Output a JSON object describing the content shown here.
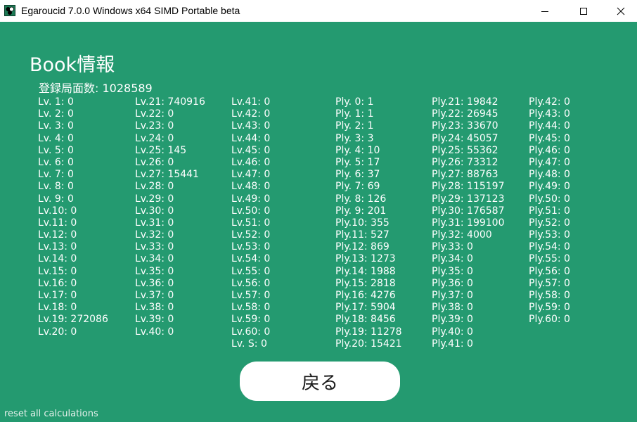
{
  "window": {
    "title": "Egaroucid 7.0.0 Windows x64 SIMD Portable beta",
    "icons": [
      "app-icon",
      "minimize-icon",
      "maximize-icon",
      "close-icon"
    ]
  },
  "book": {
    "heading": "Book情報",
    "total": "登録局面数: 1028589"
  },
  "columns": [
    [
      "Lv. 1: 0",
      "Lv. 2: 0",
      "Lv. 3: 0",
      "Lv. 4: 0",
      "Lv. 5: 0",
      "Lv. 6: 0",
      "Lv. 7: 0",
      "Lv. 8: 0",
      "Lv. 9: 0",
      "Lv.10: 0",
      "Lv.11: 0",
      "Lv.12: 0",
      "Lv.13: 0",
      "Lv.14: 0",
      "Lv.15: 0",
      "Lv.16: 0",
      "Lv.17: 0",
      "Lv.18: 0",
      "Lv.19: 272086",
      "Lv.20: 0"
    ],
    [
      "Lv.21: 740916",
      "Lv.22: 0",
      "Lv.23: 0",
      "Lv.24: 0",
      "Lv.25: 145",
      "Lv.26: 0",
      "Lv.27: 15441",
      "Lv.28: 0",
      "Lv.29: 0",
      "Lv.30: 0",
      "Lv.31: 0",
      "Lv.32: 0",
      "Lv.33: 0",
      "Lv.34: 0",
      "Lv.35: 0",
      "Lv.36: 0",
      "Lv.37: 0",
      "Lv.38: 0",
      "Lv.39: 0",
      "Lv.40: 0"
    ],
    [
      "Lv.41: 0",
      "Lv.42: 0",
      "Lv.43: 0",
      "Lv.44: 0",
      "Lv.45: 0",
      "Lv.46: 0",
      "Lv.47: 0",
      "Lv.48: 0",
      "Lv.49: 0",
      "Lv.50: 0",
      "Lv.51: 0",
      "Lv.52: 0",
      "Lv.53: 0",
      "Lv.54: 0",
      "Lv.55: 0",
      "Lv.56: 0",
      "Lv.57: 0",
      "Lv.58: 0",
      "Lv.59: 0",
      "Lv.60: 0",
      "Lv. S: 0"
    ],
    [
      "Ply. 0: 1",
      "Ply. 1: 1",
      "Ply. 2: 1",
      "Ply. 3: 3",
      "Ply. 4: 10",
      "Ply. 5: 17",
      "Ply. 6: 37",
      "Ply. 7: 69",
      "Ply. 8: 126",
      "Ply. 9: 201",
      "Ply.10: 355",
      "Ply.11: 527",
      "Ply.12: 869",
      "Ply.13: 1273",
      "Ply.14: 1988",
      "Ply.15: 2818",
      "Ply.16: 4276",
      "Ply.17: 5904",
      "Ply.18: 8456",
      "Ply.19: 11278",
      "Ply.20: 15421"
    ],
    [
      "Ply.21: 19842",
      "Ply.22: 26945",
      "Ply.23: 33670",
      "Ply.24: 45057",
      "Ply.25: 55362",
      "Ply.26: 73312",
      "Ply.27: 88763",
      "Ply.28: 115197",
      "Ply.29: 137123",
      "Ply.30: 176587",
      "Ply.31: 199100",
      "Ply.32: 4000",
      "Ply.33: 0",
      "Ply.34: 0",
      "Ply.35: 0",
      "Ply.36: 0",
      "Ply.37: 0",
      "Ply.38: 0",
      "Ply.39: 0",
      "Ply.40: 0",
      "Ply.41: 0"
    ],
    [
      "Ply.42: 0",
      "Ply.43: 0",
      "Ply.44: 0",
      "Ply.45: 0",
      "Ply.46: 0",
      "Ply.47: 0",
      "Ply.48: 0",
      "Ply.49: 0",
      "Ply.50: 0",
      "Ply.51: 0",
      "Ply.52: 0",
      "Ply.53: 0",
      "Ply.54: 0",
      "Ply.55: 0",
      "Ply.56: 0",
      "Ply.57: 0",
      "Ply.58: 0",
      "Ply.59: 0",
      "Ply.60: 0"
    ]
  ],
  "actions": {
    "back_label": "戻る",
    "reset_label": "reset all calculations"
  },
  "colors": {
    "background": "#249a70",
    "text": "#ffffff",
    "button_background": "#ffffff"
  }
}
